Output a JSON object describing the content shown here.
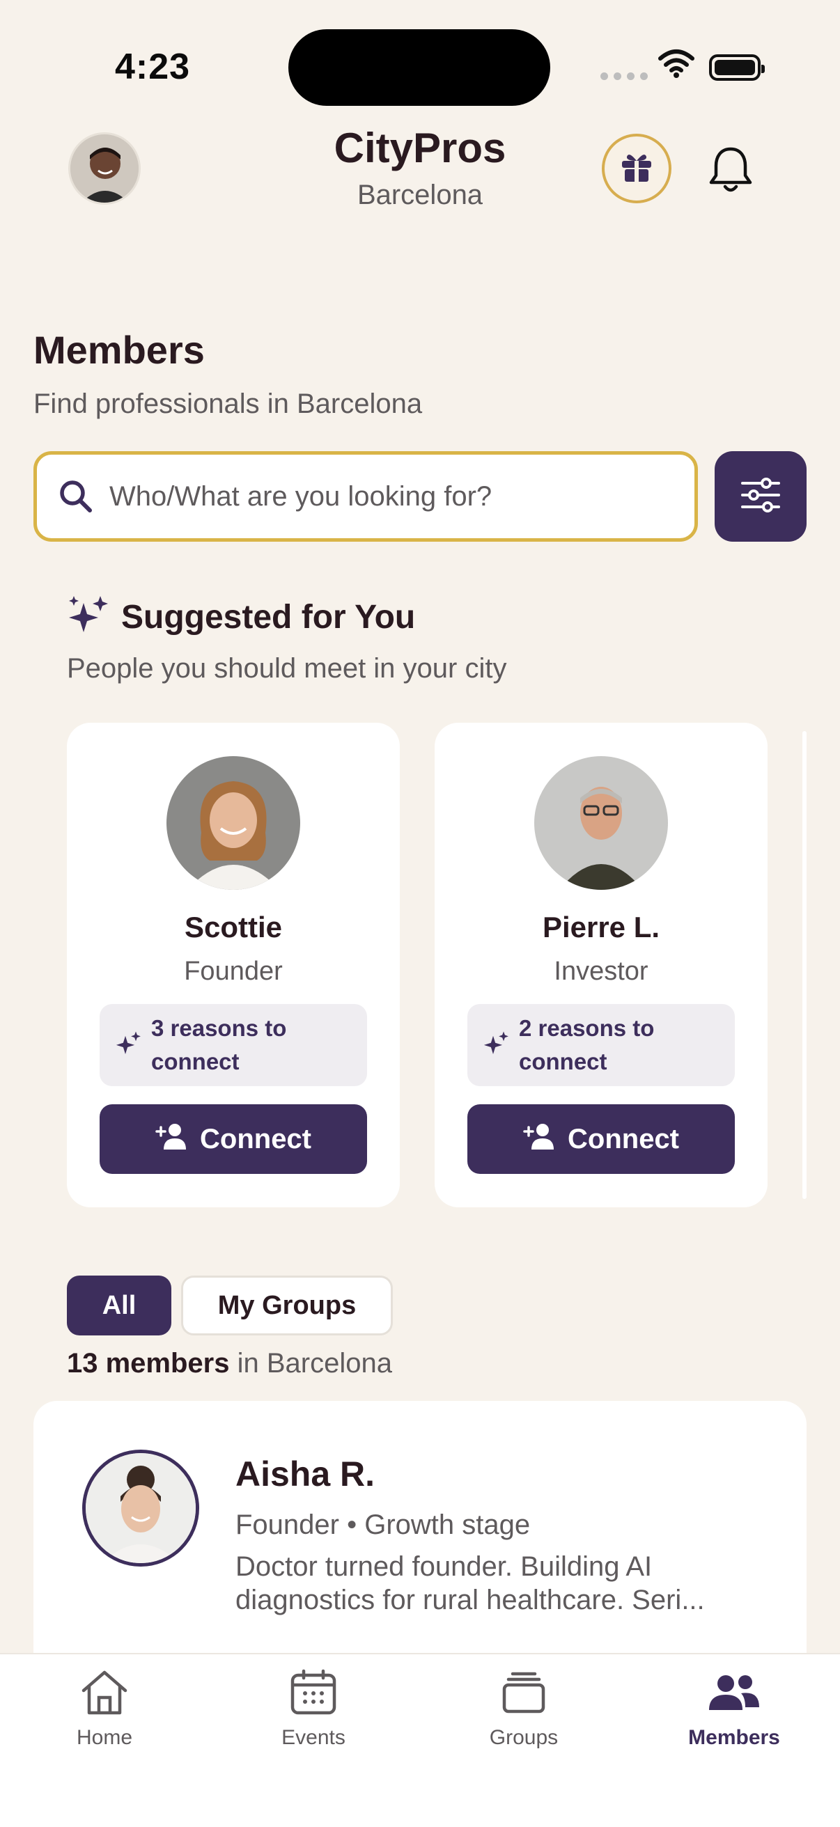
{
  "status_bar": {
    "time": "4:23"
  },
  "header": {
    "title": "CityPros",
    "city": "Barcelona",
    "profile_icon": "avatar",
    "gift_icon": "gift-icon",
    "notifications_icon": "bell-icon"
  },
  "page": {
    "title": "Members",
    "subtitle": "Find professionals in Barcelona"
  },
  "search": {
    "placeholder": "Who/What are you looking for?"
  },
  "suggested": {
    "title": "Suggested for You",
    "subtitle": "People you should meet in your city",
    "cards": [
      {
        "name": "Scottie",
        "role": "Founder",
        "reasons": "3 reasons to connect",
        "button": "Connect"
      },
      {
        "name": "Pierre L.",
        "role": "Investor",
        "reasons": "2 reasons to connect",
        "button": "Connect"
      }
    ]
  },
  "filters": {
    "all": "All",
    "groups": "My Groups"
  },
  "count": {
    "number": "13 members",
    "suffix": " in Barcelona"
  },
  "members": [
    {
      "name": "Aisha R.",
      "role": "Founder • Growth stage",
      "description": "Doctor turned founder. Building AI diagnostics for rural healthcare. Seri..."
    }
  ],
  "tabs": [
    {
      "label": "Home",
      "icon": "home-icon"
    },
    {
      "label": "Events",
      "icon": "calendar-icon"
    },
    {
      "label": "Groups",
      "icon": "stack-icon"
    },
    {
      "label": "Members",
      "icon": "people-icon",
      "active": true
    }
  ],
  "colors": {
    "background": "#F7F2EB",
    "accent": "#3D2E5C",
    "gold": "#D9B447"
  }
}
